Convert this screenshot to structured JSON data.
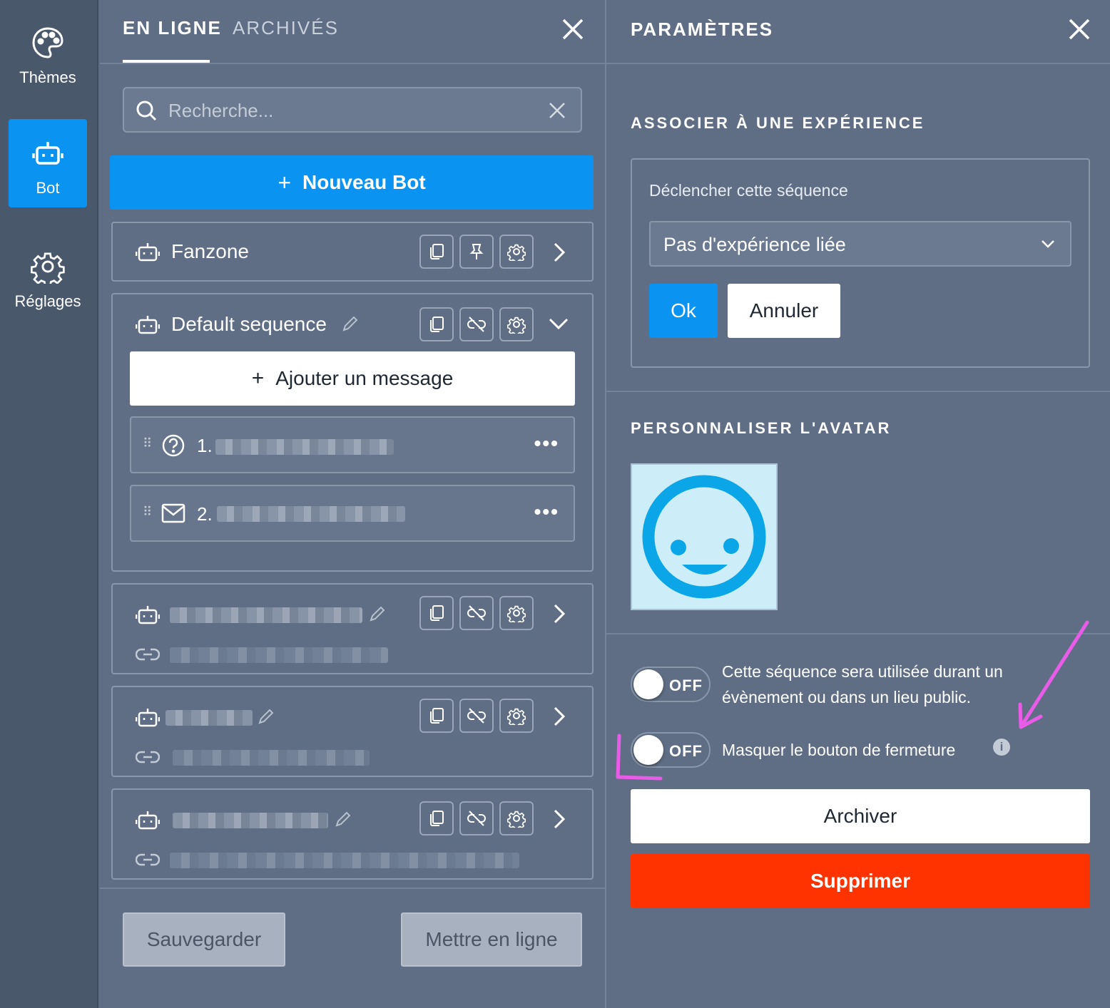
{
  "sidebar": {
    "items": [
      {
        "label": "Thèmes",
        "icon": "palette-icon"
      },
      {
        "label": "Bot",
        "icon": "robot-icon"
      },
      {
        "label": "Réglages",
        "icon": "gear-icon"
      }
    ],
    "active_color": "#0a93f0"
  },
  "list_panel": {
    "tabs": [
      {
        "label": "EN LIGNE"
      },
      {
        "label": "ARCHIVÉS"
      }
    ],
    "search": {
      "placeholder": "Recherche..."
    },
    "new_bot_label": "Nouveau Bot",
    "cards": [
      {
        "title": "Fanzone"
      },
      {
        "title": "Default sequence",
        "add_message_label": "Ajouter un message",
        "messages": [
          {
            "number": "1."
          },
          {
            "number": "2."
          }
        ]
      },
      {
        "title": ""
      },
      {
        "title": ""
      },
      {
        "title": ""
      }
    ],
    "save_label": "Sauvegarder",
    "publish_label": "Mettre en ligne"
  },
  "settings_panel": {
    "title": "PARAMÈTRES",
    "associate": {
      "heading": "ASSOCIER À UNE EXPÉRIENCE",
      "trigger_label": "Déclencher cette séquence",
      "selected": "Pas d'expérience liée",
      "ok_label": "Ok",
      "cancel_label": "Annuler"
    },
    "avatar": {
      "heading": "PERSONNALISER L'AVATAR",
      "color": "#0aa6e8"
    },
    "toggles": [
      {
        "state": "OFF",
        "text": "Cette séquence sera utilisée durant un évènement ou dans un lieu public."
      },
      {
        "state": "OFF",
        "text": "Masquer le bouton de fermeture"
      }
    ],
    "archive_label": "Archiver",
    "delete_label": "Supprimer",
    "delete_color": "#ff3300"
  }
}
